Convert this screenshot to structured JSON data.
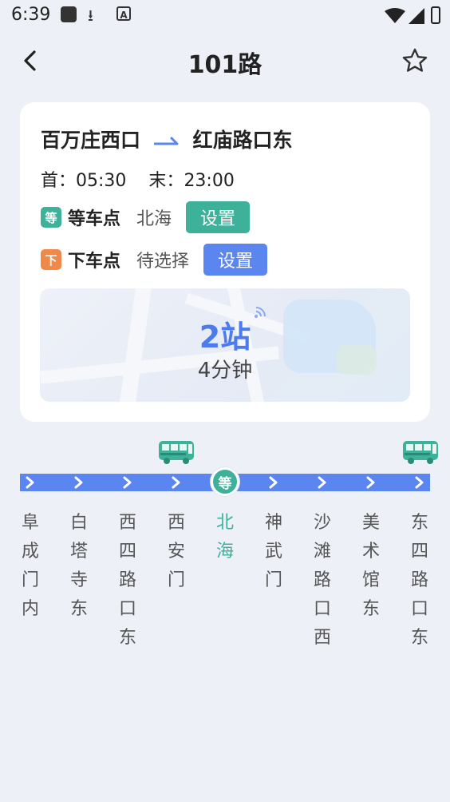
{
  "status_bar": {
    "time": "6:39"
  },
  "header": {
    "title": "101路"
  },
  "route": {
    "from": "百万庄西口",
    "to": "红庙路口东",
    "first_label": "首：",
    "first_time": "05:30",
    "last_label": "末：",
    "last_time": "23:00"
  },
  "boarding": {
    "badge": "等",
    "label": "等车点",
    "value": "北海",
    "button": "设置",
    "color": "#3db199"
  },
  "alighting": {
    "badge": "下",
    "label": "下车点",
    "value": "待选择",
    "button": "设置",
    "color": "#f0884a"
  },
  "eta": {
    "stops": "2站",
    "time": "4分钟"
  },
  "line": {
    "current_badge": "等",
    "stations": [
      {
        "name": "阜成门内"
      },
      {
        "name": "白塔寺东"
      },
      {
        "name": "西四路口东"
      },
      {
        "name": "西安门"
      },
      {
        "name": "北海",
        "current": true
      },
      {
        "name": "神武门"
      },
      {
        "name": "沙滩路口西"
      },
      {
        "name": "美术馆东"
      },
      {
        "name": "东四路口东"
      }
    ]
  },
  "colors": {
    "accent_blue": "#5b86ef",
    "accent_green": "#3db199",
    "accent_orange": "#f0884a",
    "background": "#eef0f8"
  },
  "icons": {
    "back": "chevron-left-icon",
    "favorite": "star-outline-icon",
    "bus": "bus-icon",
    "signal": "realtime-signal-icon"
  }
}
